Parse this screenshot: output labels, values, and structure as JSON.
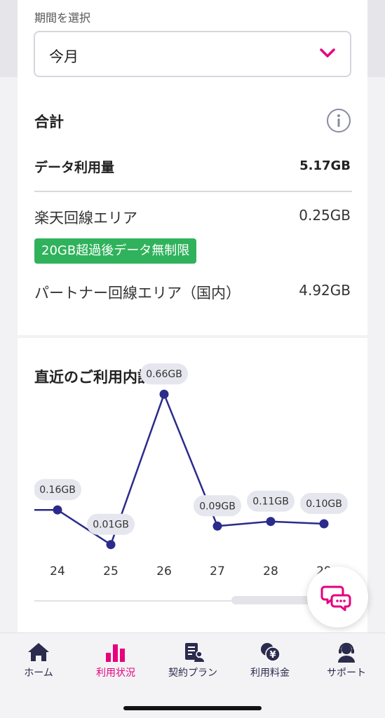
{
  "period": {
    "label": "期間を選択",
    "selected": "今月"
  },
  "total": {
    "title": "合計",
    "usage_label": "データ利用量",
    "usage_value": "5.17GB",
    "rakuten_label": "楽天回線エリア",
    "rakuten_value": "0.25GB",
    "badge": "20GB超過後データ無制限",
    "partner_label": "パートナー回線エリア（国内）",
    "partner_value": "4.92GB"
  },
  "chart_title": "直近のご利用内訳",
  "chart_data": {
    "type": "line",
    "categories": [
      "24",
      "25",
      "26",
      "27",
      "28",
      "29"
    ],
    "values": [
      0.16,
      0.01,
      0.66,
      0.09,
      0.11,
      0.1
    ],
    "data_labels": [
      "0.16GB",
      "0.01GB",
      "0.66GB",
      "0.09GB",
      "0.11GB",
      "0.10GB"
    ],
    "line_color": "#2b2b8c",
    "label_bg": "#e6e6ee"
  },
  "nav": {
    "items": [
      {
        "label": "ホーム",
        "icon": "home-icon"
      },
      {
        "label": "利用状況",
        "icon": "bar-chart-icon"
      },
      {
        "label": "契約プラン",
        "icon": "contract-icon"
      },
      {
        "label": "利用料金",
        "icon": "yen-icon"
      },
      {
        "label": "サポート",
        "icon": "support-icon"
      }
    ],
    "active_index": 1,
    "active_color": "#e6007e"
  },
  "chat": {
    "icon": "chat-bubbles-icon"
  }
}
